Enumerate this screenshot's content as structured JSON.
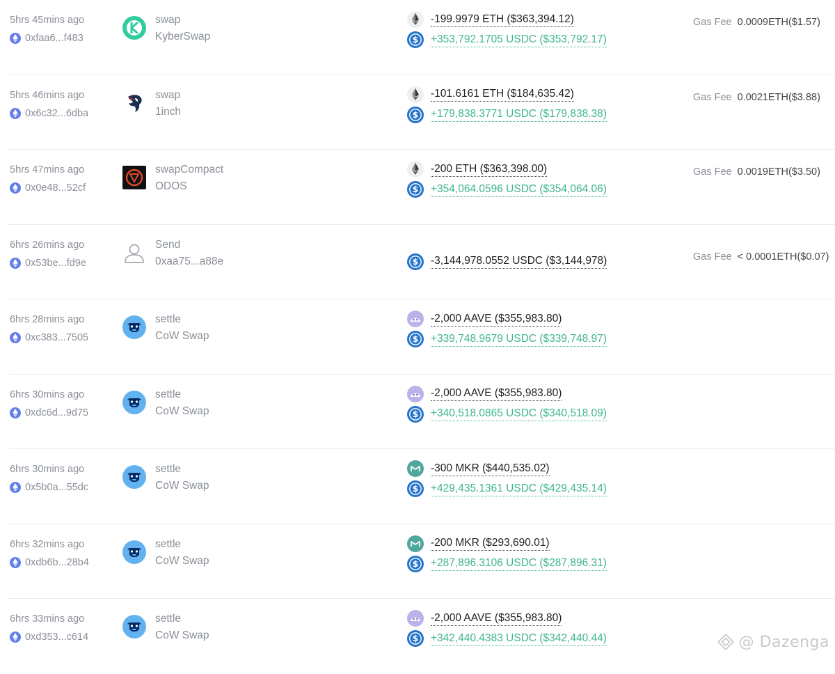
{
  "fee_label": "Gas Fee",
  "colors": {
    "positive": "#3fb68b",
    "muted": "#8a8f98",
    "usdc": "#2775ca",
    "eth_chain": "#627eea",
    "aave": "#b6509e",
    "mkr": "#4fa89b",
    "cow": "#63b2f0"
  },
  "transactions": [
    {
      "time": "5hrs 45mins ago",
      "hash": "0xfaa6...f483",
      "app_icon": "kyberswap-icon",
      "method": "swap",
      "app": "KyberSwap",
      "changes": [
        {
          "token_icon": "eth-icon",
          "dir": "out",
          "text": "-199.9979 ETH ($363,394.12)"
        },
        {
          "token_icon": "usdc-icon",
          "dir": "in",
          "text": "+353,792.1705 USDC ($353,792.17)"
        }
      ],
      "fee": "0.0009ETH($1.57)"
    },
    {
      "time": "5hrs 46mins ago",
      "hash": "0x6c32...6dba",
      "app_icon": "1inch-icon",
      "method": "swap",
      "app": "1inch",
      "changes": [
        {
          "token_icon": "eth-icon",
          "dir": "out",
          "text": "-101.6161 ETH ($184,635.42)"
        },
        {
          "token_icon": "usdc-icon",
          "dir": "in",
          "text": "+179,838.3771 USDC ($179,838.38)"
        }
      ],
      "fee": "0.0021ETH($3.88)"
    },
    {
      "time": "5hrs 47mins ago",
      "hash": "0x0e48...52cf",
      "app_icon": "odos-icon",
      "method": "swapCompact",
      "app": "ODOS",
      "changes": [
        {
          "token_icon": "eth-icon",
          "dir": "out",
          "text": "-200 ETH ($363,398.00)"
        },
        {
          "token_icon": "usdc-icon",
          "dir": "in",
          "text": "+354,064.0596 USDC ($354,064.06)"
        }
      ],
      "fee": "0.0019ETH($3.50)"
    },
    {
      "time": "6hrs 26mins ago",
      "hash": "0x53be...fd9e",
      "app_icon": "user-icon",
      "method": "Send",
      "app": "0xaa75...a88e",
      "changes": [
        {
          "token_icon": "usdc-icon",
          "dir": "out",
          "text": "-3,144,978.0552 USDC ($3,144,978)"
        }
      ],
      "fee": "< 0.0001ETH($0.07)"
    },
    {
      "time": "6hrs 28mins ago",
      "hash": "0xc383...7505",
      "app_icon": "cow-swap-icon",
      "method": "settle",
      "app": "CoW Swap",
      "changes": [
        {
          "token_icon": "aave-icon",
          "dir": "out",
          "text": "-2,000 AAVE ($355,983.80)"
        },
        {
          "token_icon": "usdc-icon",
          "dir": "in",
          "text": "+339,748.9679 USDC ($339,748.97)"
        }
      ],
      "fee": ""
    },
    {
      "time": "6hrs 30mins ago",
      "hash": "0xdc6d...9d75",
      "app_icon": "cow-swap-icon",
      "method": "settle",
      "app": "CoW Swap",
      "changes": [
        {
          "token_icon": "aave-icon",
          "dir": "out",
          "text": "-2,000 AAVE ($355,983.80)"
        },
        {
          "token_icon": "usdc-icon",
          "dir": "in",
          "text": "+340,518.0865 USDC ($340,518.09)"
        }
      ],
      "fee": ""
    },
    {
      "time": "6hrs 30mins ago",
      "hash": "0x5b0a...55dc",
      "app_icon": "cow-swap-icon",
      "method": "settle",
      "app": "CoW Swap",
      "changes": [
        {
          "token_icon": "mkr-icon",
          "dir": "out",
          "text": "-300 MKR ($440,535.02)"
        },
        {
          "token_icon": "usdc-icon",
          "dir": "in",
          "text": "+429,435.1361 USDC ($429,435.14)"
        }
      ],
      "fee": ""
    },
    {
      "time": "6hrs 32mins ago",
      "hash": "0xdb6b...28b4",
      "app_icon": "cow-swap-icon",
      "method": "settle",
      "app": "CoW Swap",
      "changes": [
        {
          "token_icon": "mkr-icon",
          "dir": "out",
          "text": "-200 MKR ($293,690.01)"
        },
        {
          "token_icon": "usdc-icon",
          "dir": "in",
          "text": "+287,896.3106 USDC ($287,896.31)"
        }
      ],
      "fee": ""
    },
    {
      "time": "6hrs 33mins ago",
      "hash": "0xd353...c614",
      "app_icon": "cow-swap-icon",
      "method": "settle",
      "app": "CoW Swap",
      "changes": [
        {
          "token_icon": "aave-icon",
          "dir": "out",
          "text": "-2,000 AAVE ($355,983.80)"
        },
        {
          "token_icon": "usdc-icon",
          "dir": "in",
          "text": "+342,440.4383 USDC ($342,440.44)"
        }
      ],
      "fee": ""
    }
  ],
  "watermark": "@ Dazenga"
}
